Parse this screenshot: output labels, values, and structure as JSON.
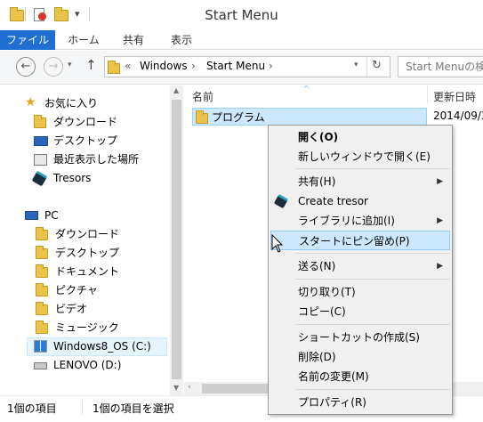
{
  "window": {
    "title": "Start Menu"
  },
  "ribbon": {
    "tabs": [
      "ファイル",
      "ホーム",
      "共有",
      "表示"
    ]
  },
  "address": {
    "overflow": "«",
    "segments": [
      "Windows",
      "Start Menu"
    ],
    "search_placeholder": "Start Menuの検"
  },
  "nav": {
    "favorites_label": "お気に入り",
    "favorites": [
      "ダウンロード",
      "デスクトップ",
      "最近表示した場所",
      "Tresors"
    ],
    "pc_label": "PC",
    "pc_items": [
      "ダウンロード",
      "デスクトップ",
      "ドキュメント",
      "ピクチャ",
      "ビデオ",
      "ミュージック"
    ],
    "drives": [
      "Windows8_OS (C:)",
      "LENOVO (D:)"
    ]
  },
  "filelist": {
    "columns": [
      "名前",
      "更新日時"
    ],
    "rows": [
      {
        "name": "プログラム",
        "date": "2014/09/3"
      }
    ]
  },
  "status": {
    "count": "1個の項目",
    "selected": "1個の項目を選択"
  },
  "context_menu": {
    "open": "開く(O)",
    "open_new_window": "新しいウィンドウで開く(E)",
    "share": "共有(H)",
    "create_tresor": "Create tresor",
    "add_to_library": "ライブラリに追加(I)",
    "pin_to_start": "スタートにピン留め(P)",
    "send_to": "送る(N)",
    "cut": "切り取り(T)",
    "copy": "コピー(C)",
    "create_shortcut": "ショートカットの作成(S)",
    "delete": "削除(D)",
    "rename": "名前の変更(M)",
    "properties": "プロパティ(R)"
  },
  "colors": {
    "accent": "#1e6fd1",
    "selection": "#cce8ff",
    "folder": "#e9c34a"
  }
}
